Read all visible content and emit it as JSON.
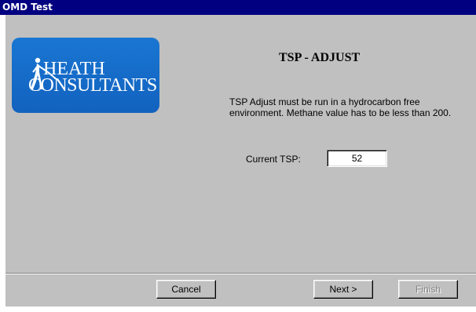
{
  "window": {
    "title": "OMD Test"
  },
  "logo": {
    "line1": "HEATH",
    "line2": "CONSULTANTS",
    "brand_color": "#1565c0"
  },
  "main": {
    "heading": "TSP - ADJUST",
    "info_text": "TSP Adjust must be run in a hydrocarbon free environment. Methane value has to be less than 200.",
    "current_tsp_label": "Current TSP:",
    "current_tsp_value": "52"
  },
  "footer": {
    "cancel_label": "Cancel",
    "next_label": "Next >",
    "finish_label": "Finish",
    "finish_enabled": false
  }
}
